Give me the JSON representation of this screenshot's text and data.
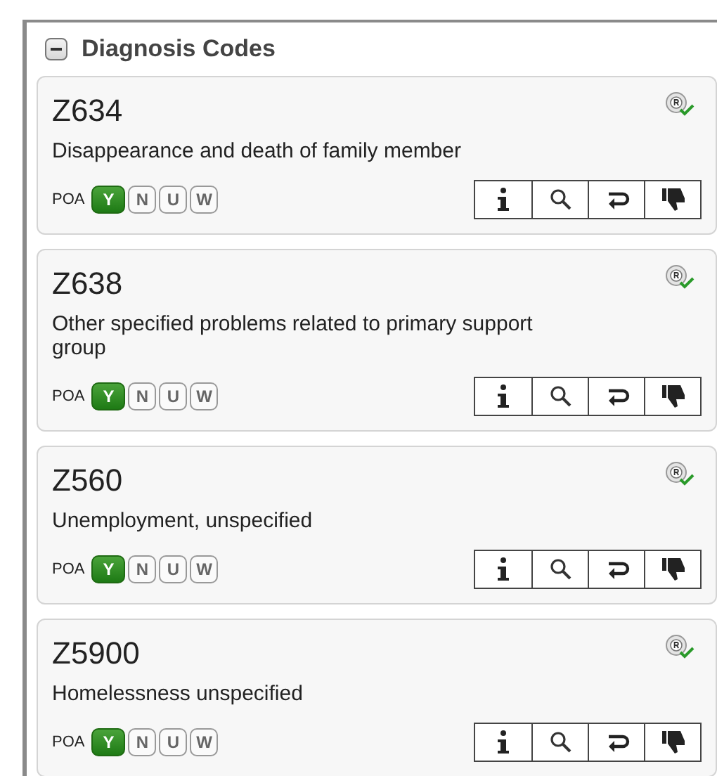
{
  "panel": {
    "title": "Diagnosis Codes",
    "expanded": true
  },
  "codes": [
    {
      "code": "Z634",
      "description": "Disappearance and death of family member",
      "poa_label": "POA",
      "poa_options": [
        {
          "label": "Y",
          "selected": true
        },
        {
          "label": "N",
          "selected": false
        },
        {
          "label": "U",
          "selected": false
        },
        {
          "label": "W",
          "selected": false
        }
      ]
    },
    {
      "code": "Z638",
      "description": "Other specified problems related to primary support group",
      "poa_label": "POA",
      "poa_options": [
        {
          "label": "Y",
          "selected": true
        },
        {
          "label": "N",
          "selected": false
        },
        {
          "label": "U",
          "selected": false
        },
        {
          "label": "W",
          "selected": false
        }
      ]
    },
    {
      "code": "Z560",
      "description": "Unemployment, unspecified",
      "poa_label": "POA",
      "poa_options": [
        {
          "label": "Y",
          "selected": true
        },
        {
          "label": "N",
          "selected": false
        },
        {
          "label": "U",
          "selected": false
        },
        {
          "label": "W",
          "selected": false
        }
      ]
    },
    {
      "code": "Z5900",
      "description": "Homelessness unspecified",
      "poa_label": "POA",
      "poa_options": [
        {
          "label": "Y",
          "selected": true
        },
        {
          "label": "N",
          "selected": false
        },
        {
          "label": "U",
          "selected": false
        },
        {
          "label": "W",
          "selected": false
        }
      ]
    }
  ]
}
